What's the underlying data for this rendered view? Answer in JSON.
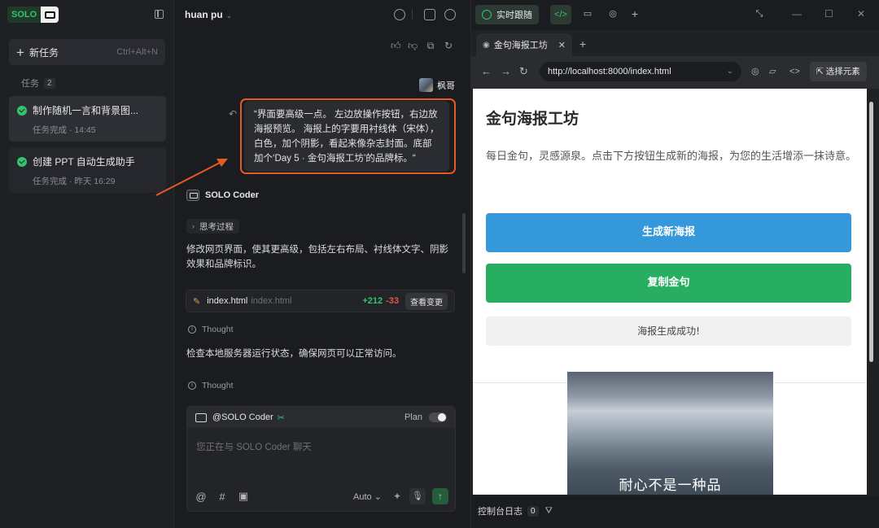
{
  "sidebar": {
    "brand": "SOLO",
    "new_task": {
      "label": "新任务",
      "shortcut": "Ctrl+Alt+N"
    },
    "tasks_header": "任务",
    "tasks_count": "2",
    "tasks": [
      {
        "title": "制作随机一言和背景图...",
        "meta": "任务完成 · 14:45"
      },
      {
        "title": "创建 PPT 自动生成助手",
        "meta": "任务完成 · 昨天 16:29"
      }
    ]
  },
  "chat": {
    "user_name": "huan pu",
    "sender_name": "枫哥",
    "user_message": "“界面要高级一点。 左边放操作按钮，右边放海报预览。 海报上的字要用衬线体（宋体），白色，加个阴影，看起来像杂志封面。底部加个‘Day 5 · 金句海报工坊’的品牌标。“",
    "coder_name": "SOLO Coder",
    "thinking_label": "思考过程",
    "response_1": "修改网页界面，使其更高级，包括左右布局、衬线体文字、阴影效果和品牌标识。",
    "file": {
      "name": "index.html",
      "path": "index.html",
      "additions": "+212",
      "deletions": "-33",
      "view_label": "查看变更"
    },
    "thought_label": "Thought",
    "response_2": "检查本地服务器运行状态，确保网页可以正常访问。",
    "composer": {
      "agent": "@SOLO Coder",
      "plan_label": "Plan",
      "placeholder": "您正在与 SOLO Coder 聊天",
      "mode": "Auto"
    }
  },
  "right": {
    "live_label": "实时跟随",
    "browser": {
      "tab_title": "金句海报工坊",
      "url": "http://localhost:8000/index.html",
      "select_element": "选择元素"
    },
    "page": {
      "title": "金句海报工坊",
      "description": "每日金句，灵感源泉。点击下方按钮生成新的海报，为您的生活增添一抹诗意。",
      "btn_generate": "生成新海报",
      "btn_copy": "复制金句",
      "status": "海报生成成功!",
      "poster_text": "耐心不是一种品"
    },
    "console_label": "控制台日志",
    "console_count": "0"
  },
  "colors": {
    "accent_green": "#35c36f",
    "highlight_orange": "#e45a1f",
    "page_blue": "#3498db",
    "page_green": "#27ae60"
  }
}
